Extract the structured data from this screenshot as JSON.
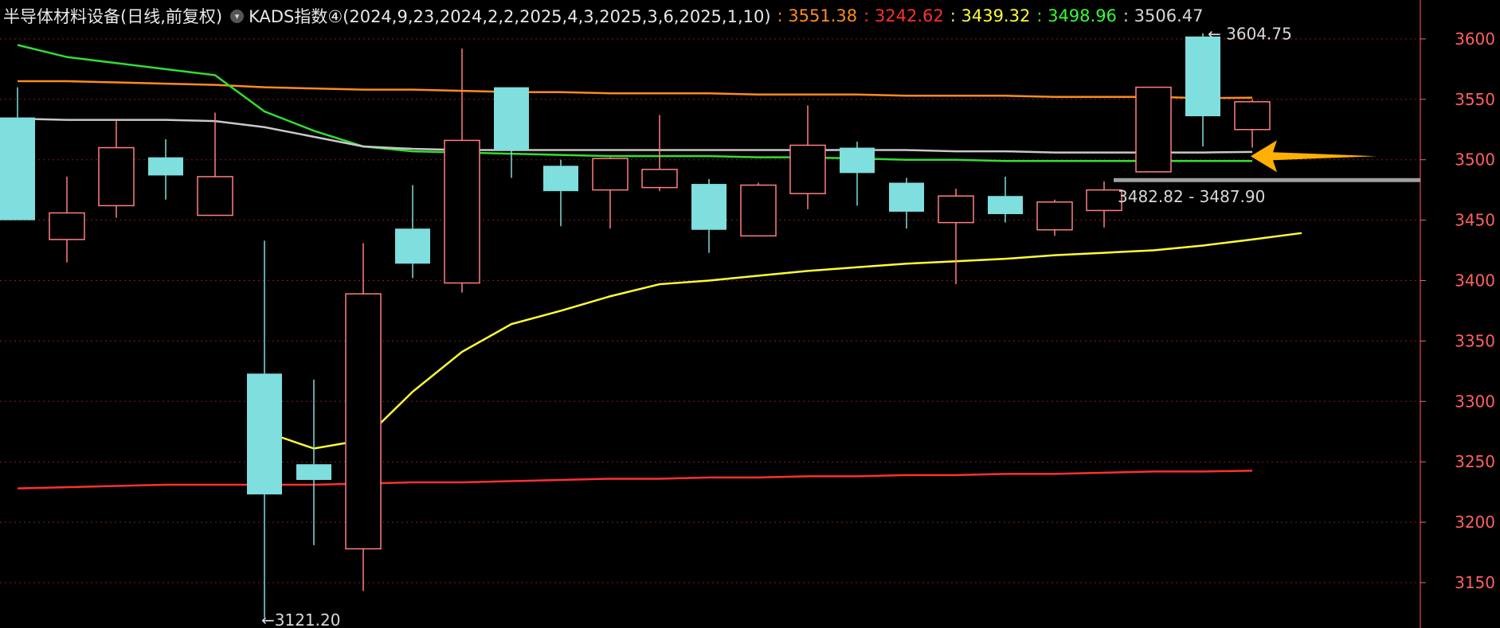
{
  "header": {
    "title": "半导体材料设备(日线,前复权)",
    "indicator_label": "KADS指数④(2024,9,23,2024,2,2,2025,4,3,2025,3,6,2025,1,10)",
    "values": [
      {
        "text": ": 3551.38",
        "color": "#ff8c1a"
      },
      {
        "text": ": 3242.62",
        "color": "#ff3030"
      },
      {
        "text": ": 3439.32",
        "color": "#ffff33"
      },
      {
        "text": ": 3498.96",
        "color": "#33ff33"
      },
      {
        "text": ": 3506.47",
        "color": "#d8d8d8"
      }
    ]
  },
  "annotations": {
    "high_label": "3604.75",
    "low_label": "3121.20",
    "range_label": "3482.82 - 3487.90",
    "low_arrow_glyph": "←",
    "high_arrow_glyph": "←"
  },
  "colors": {
    "up": "#ff7f7f",
    "down": "#7fdede",
    "axis_text": "#ff6060",
    "grid": "#8a1a1a",
    "arrow": "#ffb000",
    "support_line": "#a0a0a0",
    "label_text": "#d8d8d8"
  },
  "chart_data": {
    "type": "candlestick",
    "y_ticks": [
      3150,
      3200,
      3250,
      3300,
      3350,
      3400,
      3450,
      3500,
      3550,
      3600
    ],
    "ylim": [
      3120,
      3625
    ],
    "grid": true,
    "candles": [
      {
        "o": 3535,
        "c": 3450,
        "h": 3560,
        "l": 3450
      },
      {
        "o": 3434,
        "c": 3456,
        "h": 3486,
        "l": 3415
      },
      {
        "o": 3462,
        "c": 3510,
        "h": 3532,
        "l": 3452
      },
      {
        "o": 3502,
        "c": 3487,
        "h": 3517,
        "l": 3467
      },
      {
        "o": 3454,
        "c": 3486,
        "h": 3539,
        "l": 3454
      },
      {
        "o": 3323,
        "c": 3223,
        "h": 3433,
        "l": 3121.2
      },
      {
        "o": 3248,
        "c": 3235,
        "h": 3318,
        "l": 3181
      },
      {
        "o": 3178,
        "c": 3389,
        "h": 3431,
        "l": 3143
      },
      {
        "o": 3443,
        "c": 3414,
        "h": 3479,
        "l": 3402
      },
      {
        "o": 3398,
        "c": 3516,
        "h": 3592,
        "l": 3390
      },
      {
        "o": 3560,
        "c": 3508,
        "h": 3560,
        "l": 3485
      },
      {
        "o": 3495,
        "c": 3474,
        "h": 3500,
        "l": 3445
      },
      {
        "o": 3475,
        "c": 3501,
        "h": 3502,
        "l": 3443
      },
      {
        "o": 3477,
        "c": 3492,
        "h": 3537,
        "l": 3474
      },
      {
        "o": 3480,
        "c": 3442,
        "h": 3484,
        "l": 3423
      },
      {
        "o": 3437,
        "c": 3479,
        "h": 3481,
        "l": 3437
      },
      {
        "o": 3472,
        "c": 3512,
        "h": 3545,
        "l": 3459
      },
      {
        "o": 3510,
        "c": 3489,
        "h": 3515,
        "l": 3462
      },
      {
        "o": 3481,
        "c": 3457,
        "h": 3485,
        "l": 3443
      },
      {
        "o": 3448,
        "c": 3470,
        "h": 3476,
        "l": 3397
      },
      {
        "o": 3470,
        "c": 3455,
        "h": 3486,
        "l": 3448
      },
      {
        "o": 3442,
        "c": 3465,
        "h": 3467,
        "l": 3437
      },
      {
        "o": 3458,
        "c": 3475,
        "h": 3482,
        "l": 3444
      },
      {
        "o": 3490,
        "c": 3560,
        "h": 3560,
        "l": 3490
      },
      {
        "o": 3602,
        "c": 3536,
        "h": 3604.75,
        "l": 3511
      },
      {
        "o": 3525,
        "c": 3548,
        "h": 3550,
        "l": 3510
      }
    ],
    "series": [
      {
        "color": "#ff8c1a",
        "start": 0,
        "values": [
          3565,
          3565,
          3564,
          3563,
          3562,
          3560,
          3559,
          3558,
          3558,
          3557,
          3556,
          3556,
          3555,
          3555,
          3555,
          3554,
          3554,
          3554,
          3553,
          3553,
          3553,
          3552,
          3552,
          3552,
          3551,
          3551.38
        ]
      },
      {
        "color": "#ff3030",
        "start": 0,
        "values": [
          3228,
          3229,
          3230,
          3231,
          3231,
          3231,
          3231,
          3232,
          3233,
          3233,
          3234,
          3235,
          3236,
          3236,
          3237,
          3237,
          3238,
          3238,
          3239,
          3239,
          3240,
          3240,
          3241,
          3242,
          3242,
          3242.62
        ]
      },
      {
        "color": "#33dd33",
        "start": 0,
        "values": [
          3595,
          3585,
          3580,
          3575,
          3570,
          3540,
          3524,
          3511,
          3507,
          3506,
          3505,
          3504,
          3503,
          3503,
          3503,
          3502,
          3502,
          3501,
          3500,
          3500,
          3499,
          3499,
          3499,
          3499,
          3499,
          3498.96
        ]
      },
      {
        "color": "#c8c8c8",
        "start": 0,
        "values": [
          3534,
          3533,
          3533,
          3533,
          3532,
          3527,
          3519,
          3511,
          3509,
          3508,
          3508,
          3508,
          3508,
          3508,
          3508,
          3508,
          3508,
          3508,
          3508,
          3507,
          3507,
          3506,
          3506,
          3506,
          3506,
          3506.47
        ]
      },
      {
        "color": "#ffff33",
        "start": 5,
        "values": [
          3275,
          3261,
          3268,
          3308,
          3341,
          3364,
          3375,
          3387,
          3397,
          3400,
          3404,
          3408,
          3411,
          3414,
          3416,
          3418,
          3421,
          3423,
          3425,
          3429,
          3434,
          3439.32
        ]
      }
    ],
    "support_zone": [
      3482.82,
      3487.9
    ]
  }
}
